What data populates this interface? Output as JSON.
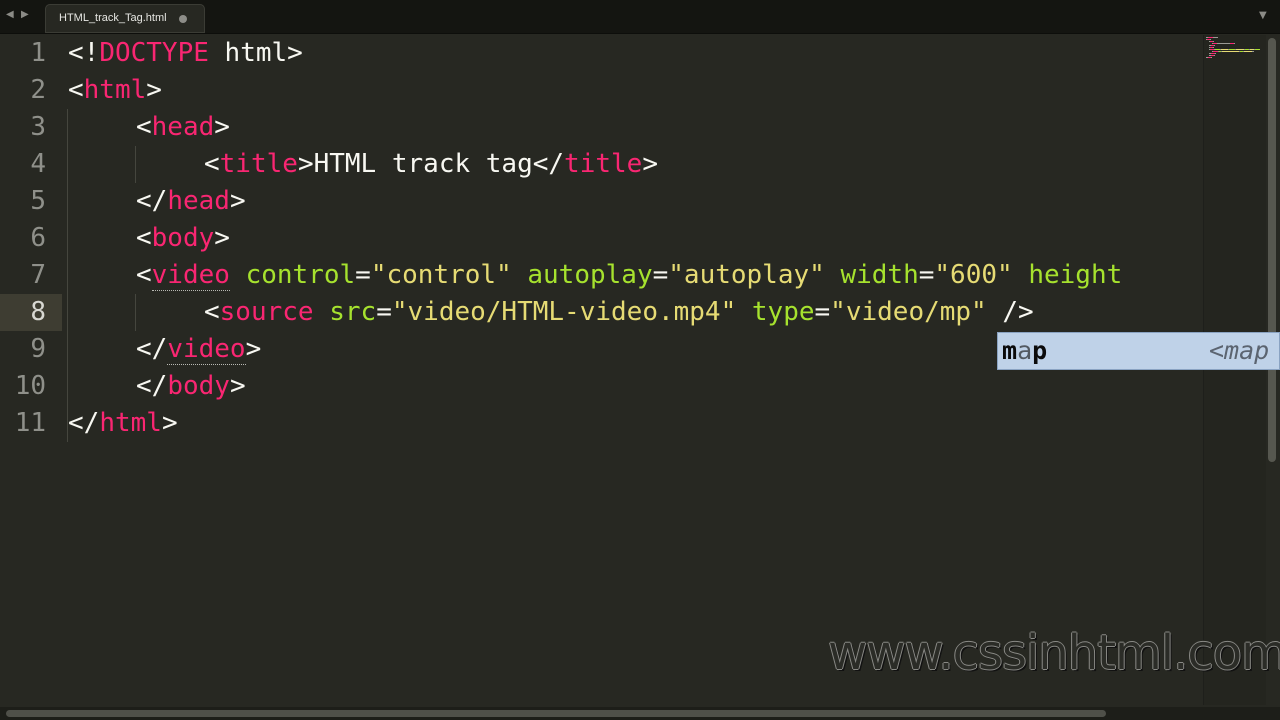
{
  "tab": {
    "filename": "HTML_track_Tag.html",
    "back_glyph": "◀",
    "forward_glyph": "▶",
    "menu_glyph": "▼"
  },
  "editor": {
    "current_line": 8,
    "line_numbers": [
      "1",
      "2",
      "3",
      "4",
      "5",
      "6",
      "7",
      "8",
      "9",
      "10",
      "11"
    ],
    "lines": [
      {
        "tokens": [
          {
            "t": "<!",
            "c": "op"
          },
          {
            "t": "DOCTYPE",
            "c": "tag"
          },
          {
            "t": " html>",
            "c": "op"
          }
        ]
      },
      {
        "tokens": [
          {
            "t": "<",
            "c": "op"
          },
          {
            "t": "html",
            "c": "tag"
          },
          {
            "t": ">",
            "c": "op"
          }
        ]
      },
      {
        "tokens": [
          {
            "t": "<",
            "c": "op"
          },
          {
            "t": "head",
            "c": "tag"
          },
          {
            "t": ">",
            "c": "op"
          }
        ]
      },
      {
        "tokens": [
          {
            "t": "<",
            "c": "op"
          },
          {
            "t": "title",
            "c": "tag"
          },
          {
            "t": ">HTML track tag</",
            "c": "op"
          },
          {
            "t": "title",
            "c": "tag"
          },
          {
            "t": ">",
            "c": "op"
          }
        ]
      },
      {
        "tokens": [
          {
            "t": "</",
            "c": "op"
          },
          {
            "t": "head",
            "c": "tag"
          },
          {
            "t": ">",
            "c": "op"
          }
        ]
      },
      {
        "tokens": [
          {
            "t": "<",
            "c": "op"
          },
          {
            "t": "body",
            "c": "tag"
          },
          {
            "t": ">",
            "c": "op"
          }
        ]
      },
      {
        "tokens": [
          {
            "t": "<",
            "c": "op"
          },
          {
            "t": "video",
            "c": "tag ul"
          },
          {
            "t": " ",
            "c": "op"
          },
          {
            "t": "control",
            "c": "attr"
          },
          {
            "t": "=",
            "c": "op"
          },
          {
            "t": "\"control\"",
            "c": "str"
          },
          {
            "t": " ",
            "c": "op"
          },
          {
            "t": "autoplay",
            "c": "attr"
          },
          {
            "t": "=",
            "c": "op"
          },
          {
            "t": "\"autoplay\"",
            "c": "str"
          },
          {
            "t": " ",
            "c": "op"
          },
          {
            "t": "width",
            "c": "attr"
          },
          {
            "t": "=",
            "c": "op"
          },
          {
            "t": "\"600\"",
            "c": "str"
          },
          {
            "t": " ",
            "c": "op"
          },
          {
            "t": "height",
            "c": "attr"
          }
        ]
      },
      {
        "tokens": [
          {
            "t": "<",
            "c": "op"
          },
          {
            "t": "source",
            "c": "tag"
          },
          {
            "t": " ",
            "c": "op"
          },
          {
            "t": "src",
            "c": "attr"
          },
          {
            "t": "=",
            "c": "op"
          },
          {
            "t": "\"video/HTML-video.mp4\"",
            "c": "str"
          },
          {
            "t": " ",
            "c": "op"
          },
          {
            "t": "type",
            "c": "attr"
          },
          {
            "t": "=",
            "c": "op"
          },
          {
            "t": "\"video/mp\"",
            "c": "str"
          },
          {
            "t": " />",
            "c": "op"
          }
        ]
      },
      {
        "tokens": [
          {
            "t": "</",
            "c": "op"
          },
          {
            "t": "video",
            "c": "tag ul"
          },
          {
            "t": ">",
            "c": "op"
          }
        ]
      },
      {
        "tokens": [
          {
            "t": "</",
            "c": "op"
          },
          {
            "t": "body",
            "c": "tag"
          },
          {
            "t": ">",
            "c": "op"
          }
        ]
      },
      {
        "tokens": [
          {
            "t": "</",
            "c": "op"
          },
          {
            "t": "html",
            "c": "tag"
          },
          {
            "t": ">",
            "c": "op"
          }
        ]
      }
    ]
  },
  "autocomplete": {
    "match_1": "m",
    "dim_part": "a",
    "match_2": "p",
    "contents": "<map"
  },
  "watermark": "www.cssinhtml.com",
  "colors": {
    "background": "#272822",
    "tag": "#f92672",
    "attribute": "#a6e22e",
    "string": "#e6db74",
    "text": "#f8f8f2"
  }
}
